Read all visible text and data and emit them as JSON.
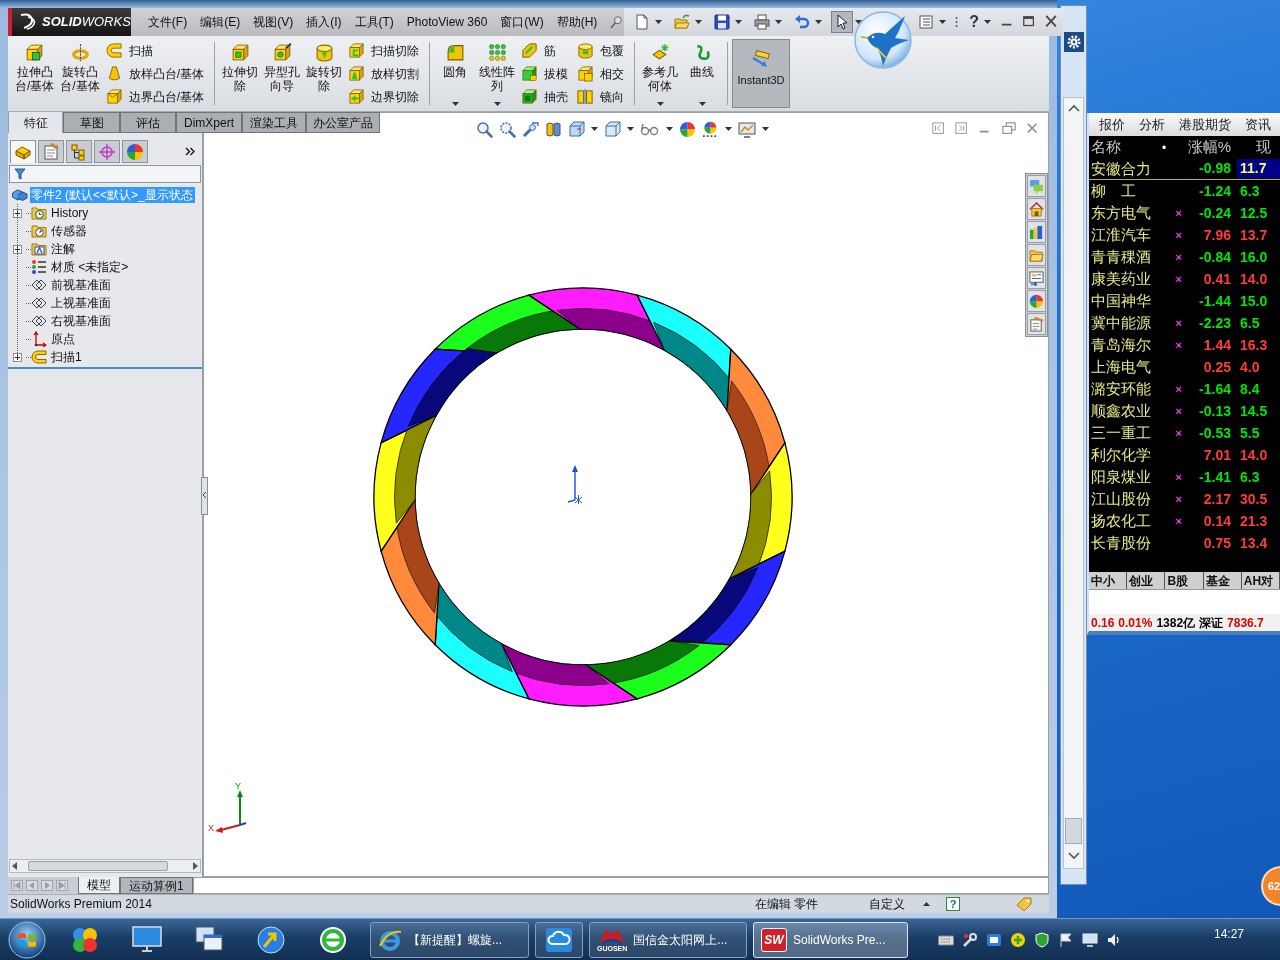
{
  "main_window": {
    "logo": "**SOLID**WORKS",
    "menu": [
      "文件(F)",
      "编辑(E)",
      "视图(V)",
      "插入(I)",
      "工具(T)",
      "PhotoView 360",
      "窗口(W)",
      "帮助(H)"
    ],
    "quick_access": [
      {
        "kind": "new",
        "pressed": false
      },
      {
        "kind": "open",
        "pressed": false
      },
      {
        "kind": "save",
        "pressed": false
      },
      {
        "kind": "print",
        "pressed": false
      },
      {
        "kind": "undo",
        "pressed": false
      },
      {
        "kind": "select",
        "pressed": true
      },
      {
        "kind": "options",
        "pressed": false
      },
      {
        "kind": "help",
        "label": "?",
        "pressed": false
      }
    ],
    "ribbon": [
      {
        "large": [
          {
            "kind": "extrude",
            "lines": [
              "拉伸凸",
              "台/基体"
            ],
            "dropdown": false
          },
          {
            "kind": "revolve",
            "lines": [
              "旋转凸",
              "台/基体"
            ],
            "dropdown": false
          }
        ],
        "small": [
          [
            {
              "kind": "sweep",
              "label": "扫描"
            },
            {
              "kind": "loft",
              "label": "放样凸台/基体"
            },
            {
              "kind": "boundary",
              "label": "边界凸台/基体"
            }
          ]
        ]
      },
      {
        "large": [
          {
            "kind": "cut-extrude",
            "lines": [
              "拉伸切",
              "除"
            ],
            "dropdown": false
          },
          {
            "kind": "hole",
            "lines": [
              "异型孔",
              "向导"
            ],
            "dropdown": false
          },
          {
            "kind": "cut-revolve",
            "lines": [
              "旋转切",
              "除"
            ],
            "dropdown": false
          }
        ],
        "small": [
          [
            {
              "kind": "cut-sweep",
              "label": "扫描切除"
            },
            {
              "kind": "cut-loft",
              "label": "放样切割"
            },
            {
              "kind": "cut-boundary",
              "label": "边界切除"
            }
          ]
        ]
      },
      {
        "large": [
          {
            "kind": "fillet",
            "lines": [
              "圆角"
            ],
            "dropdown": true
          },
          {
            "kind": "pattern",
            "lines": [
              "线性阵",
              "列"
            ],
            "dropdown": true
          }
        ],
        "small": [
          [
            {
              "kind": "rib",
              "label": "筋"
            },
            {
              "kind": "draft",
              "label": "拔模"
            },
            {
              "kind": "shell",
              "label": "抽壳"
            }
          ],
          [
            {
              "kind": "wrap",
              "label": "包覆"
            },
            {
              "kind": "intersect",
              "label": "相交"
            },
            {
              "kind": "mirror",
              "label": "镜向"
            }
          ]
        ]
      },
      {
        "large": [
          {
            "kind": "refgeom",
            "lines": [
              "参考几",
              "何体"
            ],
            "dropdown": true
          },
          {
            "kind": "curve",
            "lines": [
              "曲线"
            ],
            "dropdown": true
          }
        ]
      }
    ],
    "instant3d": {
      "label": "Instant3D",
      "pressed": true
    },
    "command_tabs": [
      {
        "label": "特征",
        "selected": true
      },
      {
        "label": "草图",
        "selected": false
      },
      {
        "label": "评估",
        "selected": false
      },
      {
        "label": "DimXpert",
        "selected": false
      },
      {
        "label": "渲染工具",
        "selected": false
      },
      {
        "label": "办公室产品",
        "selected": false
      }
    ],
    "feature_tree": {
      "tabs": [
        {
          "selected": true
        },
        {
          "selected": false
        },
        {
          "selected": false
        },
        {
          "selected": false
        },
        {
          "selected": false
        }
      ],
      "root": {
        "label": "零件2 (默认<<默认>_显示状态",
        "selected": true,
        "children": [
          {
            "label": "History",
            "kind": "history",
            "has_children": true,
            "selected": false
          },
          {
            "label": "传感器",
            "kind": "sensors",
            "has_children": false,
            "selected": false
          },
          {
            "label": "注解",
            "kind": "annotations",
            "has_children": true,
            "selected": false
          },
          {
            "label": "材质 <未指定>",
            "kind": "material",
            "has_children": false,
            "selected": false
          },
          {
            "label": "前视基准面",
            "kind": "plane",
            "has_children": false,
            "selected": false
          },
          {
            "label": "上视基准面",
            "kind": "plane",
            "has_children": false,
            "selected": false
          },
          {
            "label": "右视基准面",
            "kind": "plane",
            "has_children": false,
            "selected": false
          },
          {
            "label": "原点",
            "kind": "origin",
            "has_children": false,
            "selected": false
          },
          {
            "label": "扫描1",
            "kind": "sweep",
            "has_children": true,
            "selected": false
          }
        ]
      }
    },
    "viewport": {
      "y_label": "Y",
      "x_label": "X"
    },
    "bottom_tabs": [
      {
        "label": "模型",
        "selected": true
      },
      {
        "label": "运动算例1",
        "selected": false
      }
    ],
    "status_bar": {
      "product": "SolidWorks Premium 2014",
      "mode": "在编辑 零件",
      "units": "自定义",
      "help_label": "?"
    }
  },
  "stock_panel": {
    "tabs": [
      {
        "label": "报价",
        "selected": false
      },
      {
        "label": "分析",
        "selected": false
      },
      {
        "label": "港股期货",
        "selected": false
      },
      {
        "label": "资讯",
        "selected": false
      }
    ],
    "columns": [
      "名称",
      "•",
      "涨幅%",
      "现"
    ],
    "rows": [
      {
        "name": "安徽合力",
        "change": "-0.98",
        "price": "11.7",
        "color": "#00e600",
        "selected": true
      },
      {
        "name": "柳　工",
        "change": "-1.24",
        "price": "6.3",
        "color": "#00e600",
        "selected": false
      },
      {
        "name": "东方电气",
        "flag": "×",
        "change": "-0.24",
        "price": "12.5",
        "color": "#00e600",
        "selected": false
      },
      {
        "name": "江淮汽车",
        "flag": "×",
        "change": "7.96",
        "price": "13.7",
        "color": "#ff3c3c",
        "selected": false
      },
      {
        "name": "青青稞酒",
        "flag": "×",
        "change": "-0.84",
        "price": "16.0",
        "color": "#00e600",
        "selected": false
      },
      {
        "name": "康美药业",
        "flag": "×",
        "change": "0.41",
        "price": "14.0",
        "color": "#ff3c3c",
        "selected": false
      },
      {
        "name": "中国神华",
        "change": "-1.44",
        "price": "15.0",
        "color": "#00e600",
        "selected": false
      },
      {
        "name": "冀中能源",
        "flag": "×",
        "change": "-2.23",
        "price": "6.5",
        "color": "#00e600",
        "selected": false
      },
      {
        "name": "青岛海尔",
        "flag": "×",
        "change": "1.44",
        "price": "16.3",
        "color": "#ff3c3c",
        "selected": false
      },
      {
        "name": "上海电气",
        "change": "0.25",
        "price": "4.0",
        "color": "#ff3c3c",
        "selected": false
      },
      {
        "name": "潞安环能",
        "flag": "×",
        "change": "-1.64",
        "price": "8.4",
        "color": "#00e600",
        "selected": false
      },
      {
        "name": "顺鑫农业",
        "flag": "×",
        "change": "-0.13",
        "price": "14.5",
        "color": "#00e600",
        "selected": false
      },
      {
        "name": "三一重工",
        "flag": "×",
        "change": "-0.53",
        "price": "5.5",
        "color": "#00e600",
        "selected": false
      },
      {
        "name": "利尔化学",
        "change": "7.01",
        "price": "14.0",
        "color": "#ff3c3c",
        "selected": false
      },
      {
        "name": "阳泉煤业",
        "flag": "×",
        "change": "-1.41",
        "price": "6.3",
        "color": "#00e600",
        "selected": false
      },
      {
        "name": "江山股份",
        "flag": "×",
        "change": "2.17",
        "price": "30.5",
        "color": "#ff3c3c",
        "selected": false
      },
      {
        "name": "扬农化工",
        "flag": "×",
        "change": "0.14",
        "price": "21.3",
        "color": "#ff3c3c",
        "selected": false
      },
      {
        "name": "长青股份",
        "change": "0.75",
        "price": "13.4",
        "color": "#ff3c3c",
        "selected": false
      }
    ],
    "sectors": [
      {
        "label": "中小",
        "selected": false
      },
      {
        "label": "创业",
        "selected": false
      },
      {
        "label": "B股",
        "selected": false
      },
      {
        "label": "基金",
        "selected": false
      },
      {
        "label": "AH对",
        "selected": false
      }
    ],
    "summary": [
      {
        "text": "0.16",
        "color": "#e00000"
      },
      {
        "text": "0.01%",
        "color": "#e00000"
      },
      {
        "text": "1382亿",
        "color": "#000000"
      },
      {
        "text": "深证",
        "color": "#000000"
      },
      {
        "text": "7836.7",
        "color": "#e00000"
      }
    ]
  },
  "taskbar": {
    "tasks": [
      {
        "kind": "browser",
        "label": "【新提醒】螺旋...",
        "selected": false
      },
      {
        "kind": "cloud",
        "selected": false
      },
      {
        "kind": "trading",
        "label": "国信金太阳网上...",
        "logo_text": "GUOSEN",
        "selected": false
      },
      {
        "kind": "cad",
        "label": "SolidWorks Pre...",
        "logo_text": "SW",
        "selected": true
      }
    ],
    "clock": "14:27"
  },
  "floating_badge": "62"
}
